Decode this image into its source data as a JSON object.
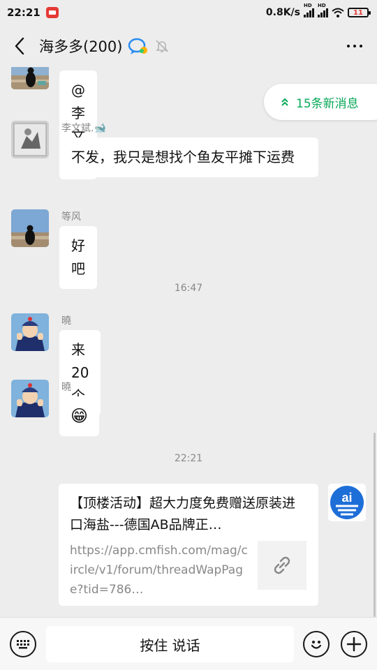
{
  "status_bar": {
    "time": "22:21",
    "net_speed": "0.8K/s",
    "hd_label": "HD",
    "battery": "11"
  },
  "header": {
    "title": "海多多(200)"
  },
  "new_messages": {
    "label": "15条新消息"
  },
  "messages": [
    {
      "text": "@李文斌"
    },
    {
      "sender": "李文斌.🐋",
      "text": "不发，我只是想找个鱼友平摊下运费"
    },
    {
      "sender": "等风",
      "text": "好吧"
    },
    {
      "sender": "曉",
      "text": "来 20 个"
    },
    {
      "sender": "曉",
      "text": "😁"
    }
  ],
  "timestamps": [
    "16:47",
    "22:21"
  ],
  "link_card": {
    "title": "【顶楼活动】超大力度免费赠送原装进口海盐---德国AB品牌正…",
    "url": "https://app.cmfish.com/mag/circle/v1/forum/threadWapPage?tid=786…"
  },
  "self_avatar": {
    "text": "ai"
  },
  "bottom_bar": {
    "voice_label": "按住 说话"
  },
  "colors": {
    "accent": "#07a858",
    "background": "#ededed",
    "badge": "#e53935"
  },
  "icons": [
    "back-icon",
    "group-badge-icon",
    "mute-bell-icon",
    "more-icon",
    "double-chevron-up-icon",
    "link-icon",
    "keyboard-icon",
    "emoji-icon",
    "plus-icon"
  ]
}
